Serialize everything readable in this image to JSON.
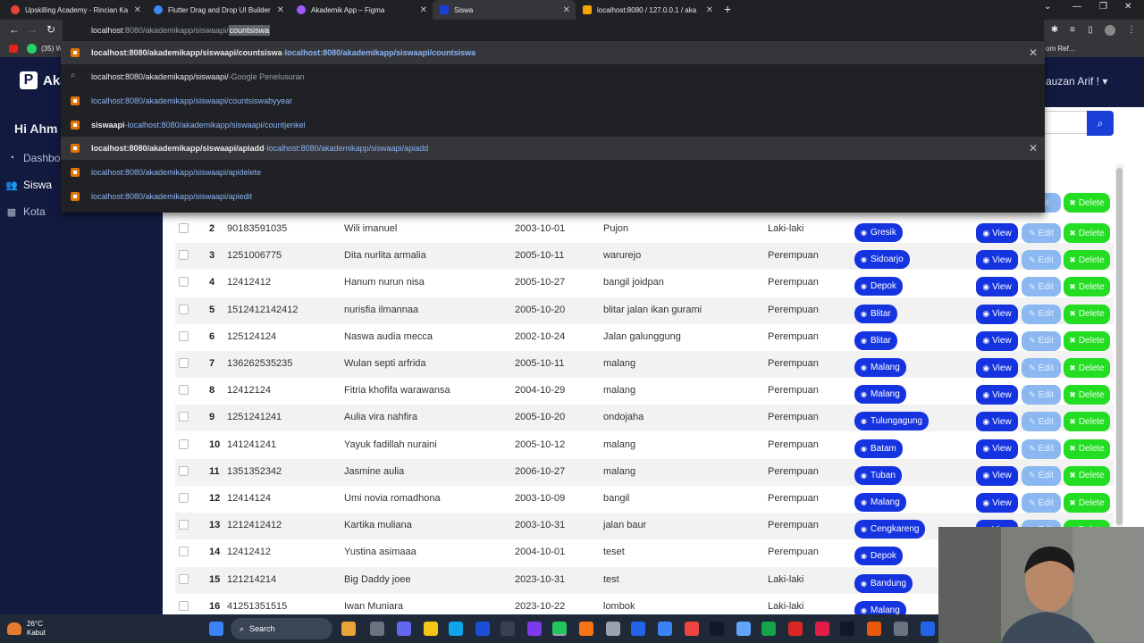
{
  "browser": {
    "tabs": [
      {
        "title": "Upskilling Academy - Rincian Ka",
        "color": "#ea4335"
      },
      {
        "title": "Flutter Drag and Drop UI Builder",
        "color": "#4285f4"
      },
      {
        "title": "Akademik App – Figma",
        "color": "#a259ff"
      },
      {
        "title": "Siswa",
        "color": "#1a3fd6"
      },
      {
        "title": "localhost:8080 / 127.0.0.1 / aka",
        "color": "#f4a300"
      }
    ],
    "omnibox": {
      "prefix": "localhost:8080/akademikapp/siswaapi/",
      "host": "localhost",
      "rest": ":8080/akademikapp/siswaapi/",
      "selected": "countsiswa"
    },
    "bookmark_fragment": "(35) W",
    "bookmark_right": "om Ref...",
    "suggestions": [
      {
        "main": "localhost:8080/akademikapp/siswaapi/countsiswa",
        "sep": " - ",
        "sub": "localhost:8080/akademikapp/siswaapi/countsiswa"
      },
      {
        "main": "localhost:8080/akademikapp/siswaapi/",
        "sep": " - ",
        "sub": "Google Penelusuran"
      },
      {
        "main": "localhost:8080/akademikapp/siswaapi/countsiswabyyear"
      },
      {
        "main": "siswaapi",
        "sep": " - ",
        "sub": "localhost:8080/akademikapp/siswaapi/countjenkel"
      },
      {
        "main": "localhost:8080/akademikapp/siswaapi/apiadd",
        "sep": " - ",
        "sub": "localhost:8080/akademikapp/siswaapi/apiadd"
      },
      {
        "main": "localhost:8080/akademikapp/siswaapi/apidelete"
      },
      {
        "main": "localhost:8080/akademikapp/siswaapi/apiedit"
      }
    ]
  },
  "app": {
    "brand": "Aka",
    "greeting": "Hi Ahm",
    "user": "auzan Arif !",
    "nav": [
      {
        "label": "Dashboa"
      },
      {
        "label": "Siswa"
      },
      {
        "label": "Kota"
      }
    ],
    "buttons": {
      "view": "View",
      "edit": "Edit",
      "delete": "Delete"
    },
    "rows": [
      {
        "no": "2",
        "nis": "90183591035",
        "nama": "Wili imanuel",
        "tgl": "2003-10-01",
        "alamat": "Pujon",
        "jk": "Laki-laki",
        "kota": "Gresik"
      },
      {
        "no": "3",
        "nis": "1251006775",
        "nama": "Dita nurlita armalia",
        "tgl": "2005-10-11",
        "alamat": "warurejo",
        "jk": "Perempuan",
        "kota": "Sidoarjo"
      },
      {
        "no": "4",
        "nis": "12412412",
        "nama": "Hanum nurun nisa",
        "tgl": "2005-10-27",
        "alamat": "bangil joidpan",
        "jk": "Perempuan",
        "kota": "Depok"
      },
      {
        "no": "5",
        "nis": "1512412142412",
        "nama": "nurisfia ilmannaa",
        "tgl": "2005-10-20",
        "alamat": "blitar jalan ikan gurami",
        "jk": "Perempuan",
        "kota": "Blitar"
      },
      {
        "no": "6",
        "nis": "125124124",
        "nama": "Naswa audia mecca",
        "tgl": "2002-10-24",
        "alamat": "Jalan galunggung",
        "jk": "Perempuan",
        "kota": "Blitar"
      },
      {
        "no": "7",
        "nis": "136262535235",
        "nama": "Wulan septi arfrida",
        "tgl": "2005-10-11",
        "alamat": "malang",
        "jk": "Perempuan",
        "kota": "Malang"
      },
      {
        "no": "8",
        "nis": "12412124",
        "nama": "Fitria khofifa warawansa",
        "tgl": "2004-10-29",
        "alamat": "malang",
        "jk": "Perempuan",
        "kota": "Malang"
      },
      {
        "no": "9",
        "nis": "1251241241",
        "nama": "Aulia vira nahfira",
        "tgl": "2005-10-20",
        "alamat": "ondojaha",
        "jk": "Perempuan",
        "kota": "Tulungagung"
      },
      {
        "no": "10",
        "nis": "141241241",
        "nama": "Yayuk fadillah nuraini",
        "tgl": "2005-10-12",
        "alamat": "malang",
        "jk": "Perempuan",
        "kota": "Batam"
      },
      {
        "no": "11",
        "nis": "1351352342",
        "nama": "Jasmine aulia",
        "tgl": "2006-10-27",
        "alamat": "malang",
        "jk": "Perempuan",
        "kota": "Tuban"
      },
      {
        "no": "12",
        "nis": "12414124",
        "nama": "Umi novia romadhona",
        "tgl": "2003-10-09",
        "alamat": "bangil",
        "jk": "Perempuan",
        "kota": "Malang"
      },
      {
        "no": "13",
        "nis": "1212412412",
        "nama": "Kartika muliana",
        "tgl": "2003-10-31",
        "alamat": "jalan baur",
        "jk": "Perempuan",
        "kota": "Cengkareng"
      },
      {
        "no": "14",
        "nis": "12412412",
        "nama": "Yustina asimaaa",
        "tgl": "2004-10-01",
        "alamat": "teset",
        "jk": "Perempuan",
        "kota": "Depok"
      },
      {
        "no": "15",
        "nis": "121214214",
        "nama": "Big Daddy joee",
        "tgl": "2023-10-31",
        "alamat": "test",
        "jk": "Laki-laki",
        "kota": "Bandung"
      },
      {
        "no": "16",
        "nis": "41251351515",
        "nama": "Iwan Muniara",
        "tgl": "2023-10-22",
        "alamat": "lombok",
        "jk": "Laki-laki",
        "kota": "Malang"
      }
    ]
  },
  "taskbar": {
    "temp": "26°C",
    "condition": "Kabut",
    "search": "Search"
  }
}
